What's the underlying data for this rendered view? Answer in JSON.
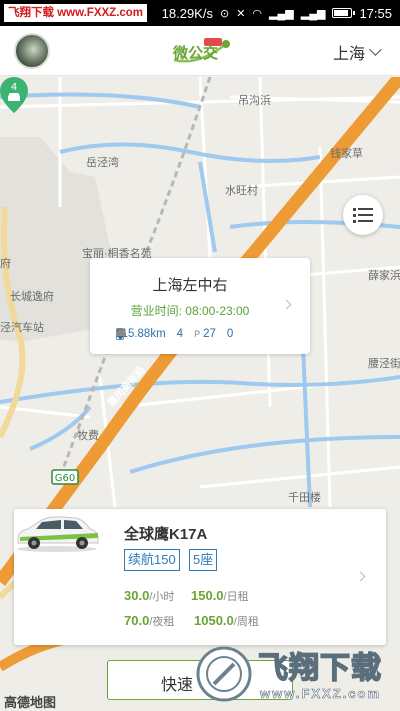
{
  "status_bar": {
    "watermark": "飞翔下载 www.FXXZ.com",
    "speed": "18.29K/s",
    "time": "17:55",
    "battery_level": 0.9
  },
  "header": {
    "logo_text": "微公交",
    "city": "上海"
  },
  "map": {
    "labels": [
      "吊沟浜",
      "钱家草",
      "岳泾湾",
      "水旺村",
      "宝丽·桐香名苑",
      "府",
      "长城逸府",
      "薛家浜",
      "泾汽车站",
      "腰泾街",
      "牧费",
      "G60",
      "千田楼"
    ],
    "road_name": "嘉闵高架路",
    "credit": "高德地图"
  },
  "station": {
    "name": "上海左中右",
    "hours": "营业时间: 08:00-23:00",
    "distance": "115.88km",
    "cars": "4",
    "parking": "27",
    "chargers": "0",
    "pin_count": "4"
  },
  "car": {
    "name": "全球鹰K17A",
    "tags": [
      "续航150",
      "5座"
    ],
    "prices": [
      {
        "value": "30.0",
        "unit": "/小时"
      },
      {
        "value": "150.0",
        "unit": "/日租"
      },
      {
        "value": "70.0",
        "unit": "/夜租"
      },
      {
        "value": "1050.0",
        "unit": "/周租"
      }
    ]
  },
  "actions": {
    "quick_label": "快速"
  },
  "watermark_bottom": {
    "text": "飞翔下载",
    "url": "www.FXXZ.com"
  }
}
